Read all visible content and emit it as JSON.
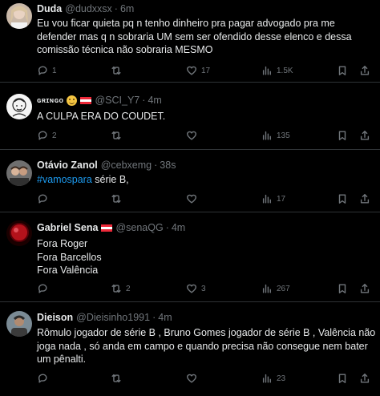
{
  "tweets": [
    {
      "name": "Duda",
      "handle": "@dudxxsx",
      "dot": "·",
      "time": "6m",
      "lines": [
        "Eu vou ficar quieta pq n tenho dinheiro pra pagar advogado pra me",
        "defender mas q n sobraria UM sem ser ofendido desse elenco e dessa",
        "comissão técnica não sobraria MESMO"
      ],
      "replies": "1",
      "retweets": "",
      "likes": "17",
      "views": "1.5K"
    },
    {
      "name": "ɢʀɪɴɢᴏ",
      "handle": "@SCI_Y7",
      "dot": "·",
      "time": "4m",
      "lines": [
        "A CULPA ERA DO COUDET."
      ],
      "replies": "2",
      "retweets": "",
      "likes": "",
      "views": "135"
    },
    {
      "name": "Otávio Zanol",
      "handle": "@cebxemg",
      "dot": "·",
      "time": "38s",
      "hashtag": "#vamospara",
      "text_after_hashtag": " série B,",
      "replies": "",
      "retweets": "",
      "likes": "",
      "views": "17"
    },
    {
      "name": "Gabriel Sena",
      "handle": "@senaQG",
      "dot": "·",
      "time": "4m",
      "lines": [
        "Fora Roger",
        "Fora Barcellos",
        "Fora Valência"
      ],
      "replies": "",
      "retweets": "2",
      "likes": "3",
      "views": "267"
    },
    {
      "name": "Dieison",
      "handle": "@Dieisinho1991",
      "dot": "·",
      "time": "4m",
      "lines": [
        "Rômulo jogador de série B , Bruno Gomes jogador de série B , Valência não",
        "joga nada , só anda em campo e quando precisa não consegue nem bater",
        "um pênalti."
      ],
      "replies": "",
      "retweets": "",
      "likes": "",
      "views": "23"
    }
  ],
  "icons": {
    "reply": "reply-icon",
    "retweet": "retweet-icon",
    "like": "heart-icon",
    "views": "views-icon",
    "bookmark": "bookmark-icon",
    "share": "share-icon"
  },
  "colors": {
    "background": "#000000",
    "text": "#e7e9ea",
    "muted": "#71767b",
    "link": "#1d9bf0",
    "divider": "#2f3336"
  }
}
